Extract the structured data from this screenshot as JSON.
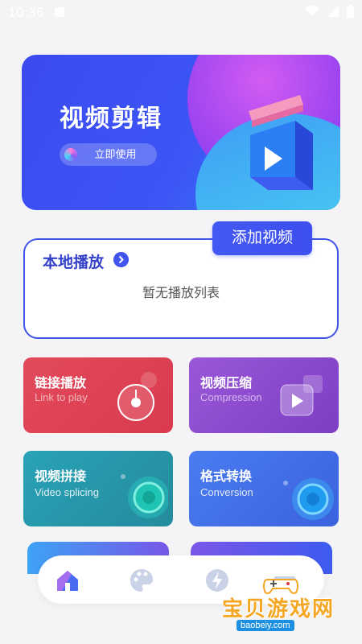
{
  "status_bar": {
    "time": "10:36"
  },
  "hero": {
    "title": "视频剪辑",
    "button_label": "立即使用"
  },
  "player": {
    "add_button": "添加视频",
    "title": "本地播放",
    "empty_text": "暂无播放列表"
  },
  "tiles": [
    {
      "title": "链接播放",
      "subtitle": "Link to play",
      "color": "#e24a5b"
    },
    {
      "title": "视频压缩",
      "subtitle": "Compression",
      "color": "#9a57d8"
    },
    {
      "title": "视频拼接",
      "subtitle": "Video splicing",
      "color": "#2aa2b7"
    },
    {
      "title": "格式转换",
      "subtitle": "Conversion",
      "color": "#4a7cf0"
    }
  ],
  "nav": {
    "items": [
      "home-icon",
      "palette-icon",
      "lightning-icon",
      "gamepad-icon"
    ]
  },
  "watermark": {
    "text": "宝贝游戏网",
    "url": "baobeiy.com"
  },
  "colors": {
    "accent": "#4053e8"
  }
}
